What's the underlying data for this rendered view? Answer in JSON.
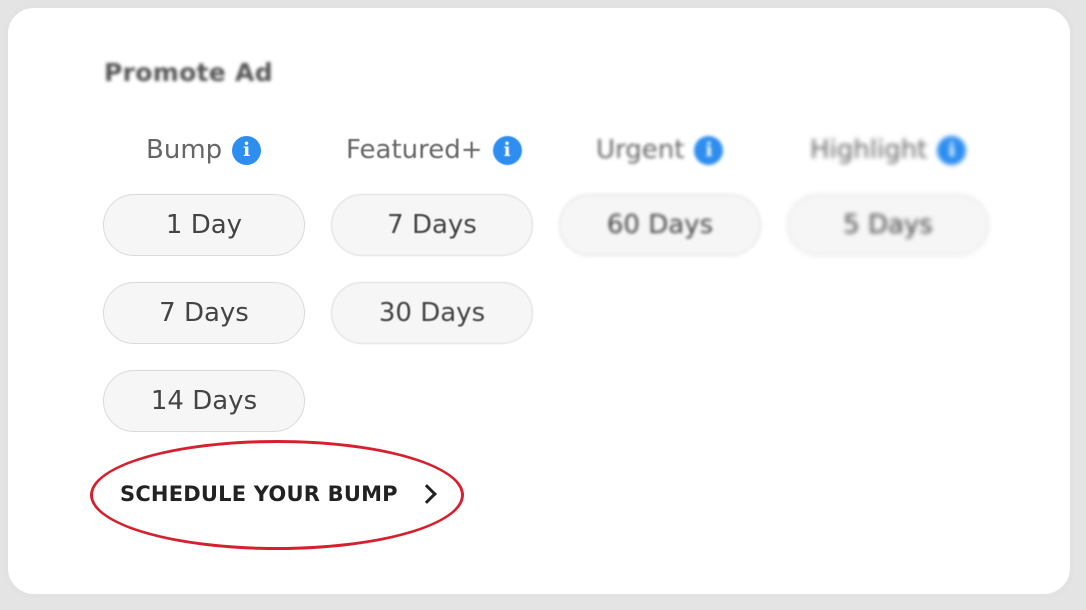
{
  "title": "Promote Ad",
  "accent_color": "#2d8ef0",
  "annotation_color": "#d6202f",
  "columns": [
    {
      "label": "Bump",
      "info_icon": "i",
      "options": [
        "1 Day",
        "7 Days",
        "14 Days"
      ]
    },
    {
      "label": "Featured+",
      "info_icon": "i",
      "options": [
        "7 Days",
        "30 Days"
      ]
    },
    {
      "label": "Urgent",
      "info_icon": "i",
      "options": [
        "60 Days"
      ]
    },
    {
      "label": "Highlight",
      "info_icon": "i",
      "options": [
        "5 Days"
      ]
    }
  ],
  "schedule_link": {
    "label": "SCHEDULE YOUR BUMP",
    "icon": "chevron-right-icon"
  }
}
